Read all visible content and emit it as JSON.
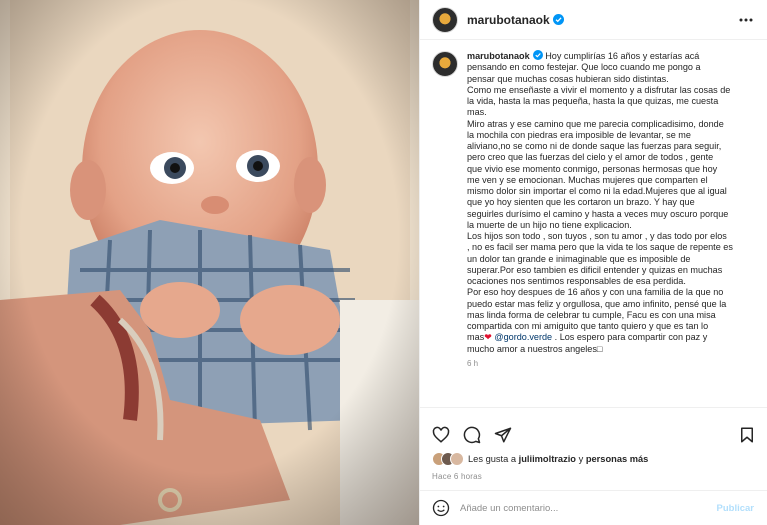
{
  "post": {
    "username": "marubotanaok",
    "verified": true,
    "more_icon": "more-horizontal-icon",
    "photo_description_icon": "baby-photo"
  },
  "caption": {
    "username": "marubotanaok",
    "text_lines": [
      " Hoy cumplirías 16 años y estarías acá",
      "pensando en como festejar. Que loco cuando me pongo a",
      "pensar que muchas cosas hubieran sido distintas.",
      "Como me enseñaste a vivir el momento y a disfrutar las cosas de",
      "la vida, hasta la mas pequeña, hasta la que quizas, me cuesta",
      "mas.",
      "Miro atras y ese camino que me parecia complicadisimo, donde",
      "la mochila con piedras era imposible de levantar, se me",
      "aliviano,no se como ni de donde saque las fuerzas para seguir,",
      "pero creo que las fuerzas del cielo y el amor de todos , gente",
      "que vivio ese momento conmigo, personas hermosas que hoy",
      "me ven y se emocionan. Muchas mujeres que comparten el",
      "mismo dolor sin importar el como ni la edad.Mujeres que al igual",
      "que yo hoy sienten que les cortaron un brazo. Y hay que",
      "seguirles durísimo el camino y hasta a veces muy oscuro porque",
      "la muerte de un hijo no tiene explicacion.",
      "Los hijos son todo , son tuyos , son tu amor , y das todo por elos",
      ", no es facil ser mama pero que la vida te los saque de repente es",
      "un dolor tan grande e inimaginable que es imposible de",
      "superar.Por eso tambien es dificil entender y quizas en muchas",
      "ocaciones nos sentimos responsables de esa perdida.",
      "Por eso hoy despues de 16 años y con una familia de la que no",
      "puedo estar mas feliz y orgullosa, que amo infinito, pensé que la",
      "mas linda forma de celebrar tu cumple, Facu es con una misa",
      "compartida con mi amiguito que tanto quiero y que es tan lo"
    ],
    "last_line_prefix": "mas",
    "heart": "❤",
    "mention": "@gordo.verde",
    "last_line_suffix": " . Los espero para compartir con paz y",
    "final_line": "mucho amor a nuestros angeles",
    "final_glyph": "□",
    "time": "6 h"
  },
  "actions": {
    "like_icon": "heart-icon",
    "comment_icon": "comment-icon",
    "share_icon": "share-icon",
    "save_icon": "bookmark-icon"
  },
  "likes": {
    "prefix": "Les gusta a ",
    "user": "juliimoltrazio",
    "middle": " y ",
    "others": "personas más"
  },
  "timestamp": "Hace 6 horas",
  "comment": {
    "placeholder": "Añade un comentario...",
    "publish_label": "Publicar",
    "emoji_icon": "emoji-icon"
  },
  "colors": {
    "verified_blue": "#0095f6",
    "publish_disabled": "#b2dffc",
    "heart_red": "#e0102e"
  }
}
